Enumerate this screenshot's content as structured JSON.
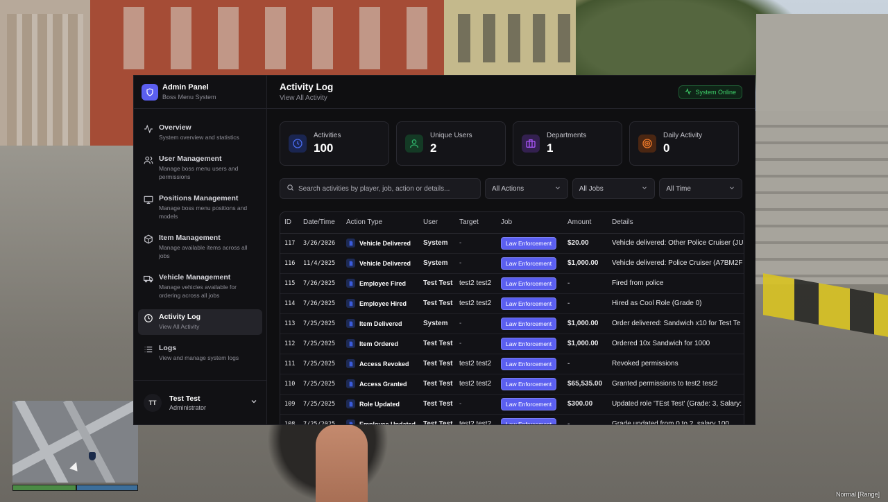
{
  "sidebar": {
    "brand_title": "Admin Panel",
    "brand_subtitle": "Boss Menu System",
    "items": [
      {
        "title": "Overview",
        "desc": "System overview and statistics",
        "icon": "activity-icon"
      },
      {
        "title": "User Management",
        "desc": "Manage boss menu users and permissions",
        "icon": "users-icon"
      },
      {
        "title": "Positions Management",
        "desc": "Manage boss menu positions and models",
        "icon": "monitor-icon"
      },
      {
        "title": "Item Management",
        "desc": "Manage available items across all jobs",
        "icon": "box-icon"
      },
      {
        "title": "Vehicle Management",
        "desc": "Manage vehicles available for ordering across all jobs",
        "icon": "truck-icon"
      },
      {
        "title": "Activity Log",
        "desc": "View All Activity",
        "icon": "clock-icon",
        "active": true
      },
      {
        "title": "Logs",
        "desc": "View and manage system logs",
        "icon": "list-icon"
      }
    ],
    "user": {
      "initials": "TT",
      "name": "Test Test",
      "role": "Administrator"
    }
  },
  "header": {
    "title": "Activity Log",
    "subtitle": "View All Activity",
    "status": "System Online"
  },
  "stats": [
    {
      "label": "Activities",
      "value": "100",
      "icon": "clock-icon",
      "color": "#3b5bdb",
      "bg": "#1a2550"
    },
    {
      "label": "Unique Users",
      "value": "2",
      "icon": "user-icon",
      "color": "#2fb36b",
      "bg": "#143a25"
    },
    {
      "label": "Departments",
      "value": "1",
      "icon": "briefcase-icon",
      "color": "#a855f7",
      "bg": "#33204f"
    },
    {
      "label": "Daily Activity",
      "value": "0",
      "icon": "target-icon",
      "color": "#f07a2a",
      "bg": "#4a2612"
    }
  ],
  "filters": {
    "search_placeholder": "Search activities by player, job, action or details...",
    "actions": "All Actions",
    "jobs": "All Jobs",
    "time": "All Time"
  },
  "table": {
    "columns": [
      "ID",
      "Date/Time",
      "Action Type",
      "User",
      "Target",
      "Job",
      "Amount",
      "Details"
    ],
    "rows": [
      {
        "id": "117",
        "date": "3/26/2026",
        "action": "Vehicle Delivered",
        "user": "System",
        "target": "-",
        "job": "Law Enforcement",
        "amount": "$20.00",
        "details": "Vehicle delivered: Other Police Cruiser (JU"
      },
      {
        "id": "116",
        "date": "11/4/2025",
        "action": "Vehicle Delivered",
        "user": "System",
        "target": "-",
        "job": "Law Enforcement",
        "amount": "$1,000.00",
        "details": "Vehicle delivered: Police Cruiser (A7BM2F"
      },
      {
        "id": "115",
        "date": "7/26/2025",
        "action": "Employee Fired",
        "user": "Test Test",
        "target": "test2 test2",
        "job": "Law Enforcement",
        "amount": "-",
        "details": "Fired from police"
      },
      {
        "id": "114",
        "date": "7/26/2025",
        "action": "Employee Hired",
        "user": "Test Test",
        "target": "test2 test2",
        "job": "Law Enforcement",
        "amount": "-",
        "details": "Hired as Cool Role (Grade 0)"
      },
      {
        "id": "113",
        "date": "7/25/2025",
        "action": "Item Delivered",
        "user": "System",
        "target": "-",
        "job": "Law Enforcement",
        "amount": "$1,000.00",
        "details": "Order delivered: Sandwich x10 for Test Te"
      },
      {
        "id": "112",
        "date": "7/25/2025",
        "action": "Item Ordered",
        "user": "Test Test",
        "target": "-",
        "job": "Law Enforcement",
        "amount": "$1,000.00",
        "details": "Ordered 10x Sandwich for 1000"
      },
      {
        "id": "111",
        "date": "7/25/2025",
        "action": "Access Revoked",
        "user": "Test Test",
        "target": "test2 test2",
        "job": "Law Enforcement",
        "amount": "-",
        "details": "Revoked permissions"
      },
      {
        "id": "110",
        "date": "7/25/2025",
        "action": "Access Granted",
        "user": "Test Test",
        "target": "test2 test2",
        "job": "Law Enforcement",
        "amount": "$65,535.00",
        "details": "Granted permissions to test2 test2"
      },
      {
        "id": "109",
        "date": "7/25/2025",
        "action": "Role Updated",
        "user": "Test Test",
        "target": "-",
        "job": "Law Enforcement",
        "amount": "$300.00",
        "details": "Updated role 'TEst Test' (Grade: 3, Salary:"
      },
      {
        "id": "108",
        "date": "7/25/2025",
        "action": "Employee Updated",
        "user": "Test Test",
        "target": "test2 test2",
        "job": "Law Enforcement",
        "amount": "-",
        "details": "Grade updated from 0 to 2, salary 100"
      }
    ]
  },
  "hud": {
    "voice": "Normal [Range]"
  }
}
